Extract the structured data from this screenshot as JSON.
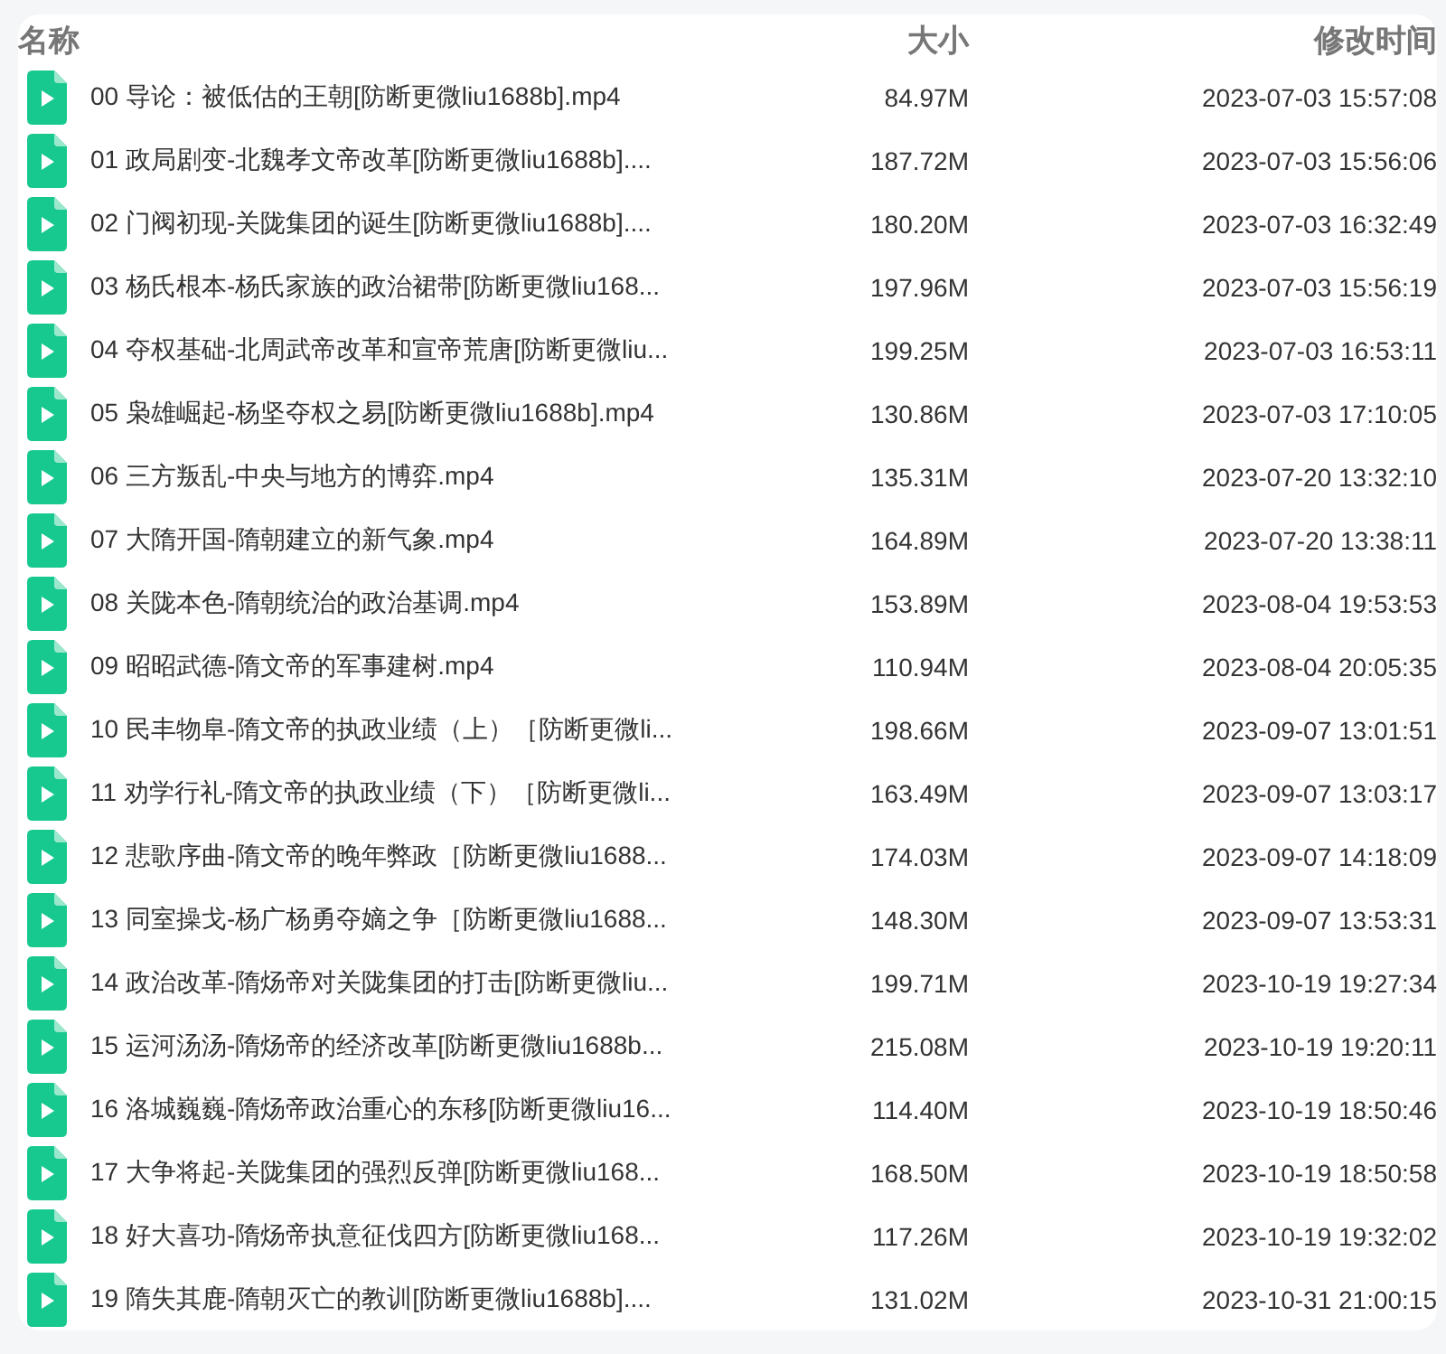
{
  "table": {
    "columns": [
      "名称",
      "大小",
      "修改时间"
    ],
    "rows": [
      {
        "name": "00 导论：被低估的王朝[防断更微liu1688b].mp4",
        "size": "84.97M",
        "modified": "2023-07-03 15:57:08"
      },
      {
        "name": "01 政局剧变-北魏孝文帝改革[防断更微liu1688b]....",
        "size": "187.72M",
        "modified": "2023-07-03 15:56:06"
      },
      {
        "name": "02 门阀初现-关陇集团的诞生[防断更微liu1688b]....",
        "size": "180.20M",
        "modified": "2023-07-03 16:32:49"
      },
      {
        "name": "03 杨氏根本-杨氏家族的政治裙带[防断更微liu168...",
        "size": "197.96M",
        "modified": "2023-07-03 15:56:19"
      },
      {
        "name": "04 夺权基础-北周武帝改革和宣帝荒唐[防断更微liu...",
        "size": "199.25M",
        "modified": "2023-07-03 16:53:11"
      },
      {
        "name": "05 枭雄崛起-杨坚夺权之易[防断更微liu1688b].mp4",
        "size": "130.86M",
        "modified": "2023-07-03 17:10:05"
      },
      {
        "name": "06 三方叛乱-中央与地方的博弈.mp4",
        "size": "135.31M",
        "modified": "2023-07-20 13:32:10"
      },
      {
        "name": "07 大隋开国-隋朝建立的新气象.mp4",
        "size": "164.89M",
        "modified": "2023-07-20 13:38:11"
      },
      {
        "name": "08 关陇本色-隋朝统治的政治基调.mp4",
        "size": "153.89M",
        "modified": "2023-08-04 19:53:53"
      },
      {
        "name": "09 昭昭武德-隋文帝的军事建树.mp4",
        "size": "110.94M",
        "modified": "2023-08-04 20:05:35"
      },
      {
        "name": "10 民丰物阜-隋文帝的执政业绩（上）［防断更微li...",
        "size": "198.66M",
        "modified": "2023-09-07 13:01:51"
      },
      {
        "name": "11 劝学行礼-隋文帝的执政业绩（下）［防断更微li...",
        "size": "163.49M",
        "modified": "2023-09-07 13:03:17"
      },
      {
        "name": "12 悲歌序曲-隋文帝的晚年弊政［防断更微liu1688...",
        "size": "174.03M",
        "modified": "2023-09-07 14:18:09"
      },
      {
        "name": "13 同室操戈-杨广杨勇夺嫡之争［防断更微liu1688...",
        "size": "148.30M",
        "modified": "2023-09-07 13:53:31"
      },
      {
        "name": "14 政治改革-隋炀帝对关陇集团的打击[防断更微liu...",
        "size": "199.71M",
        "modified": "2023-10-19 19:27:34"
      },
      {
        "name": "15 运河汤汤-隋炀帝的经济改革[防断更微liu1688b...",
        "size": "215.08M",
        "modified": "2023-10-19 19:20:11"
      },
      {
        "name": "16 洛城巍巍-隋炀帝政治重心的东移[防断更微liu16...",
        "size": "114.40M",
        "modified": "2023-10-19 18:50:46"
      },
      {
        "name": "17 大争将起-关陇集团的强烈反弹[防断更微liu168...",
        "size": "168.50M",
        "modified": "2023-10-19 18:50:58"
      },
      {
        "name": "18 好大喜功-隋炀帝执意征伐四方[防断更微liu168...",
        "size": "117.26M",
        "modified": "2023-10-19 19:32:02"
      },
      {
        "name": "19 隋失其鹿-隋朝灭亡的教训[防断更微liu1688b]....",
        "size": "131.02M",
        "modified": "2023-10-31 21:00:15"
      }
    ]
  }
}
